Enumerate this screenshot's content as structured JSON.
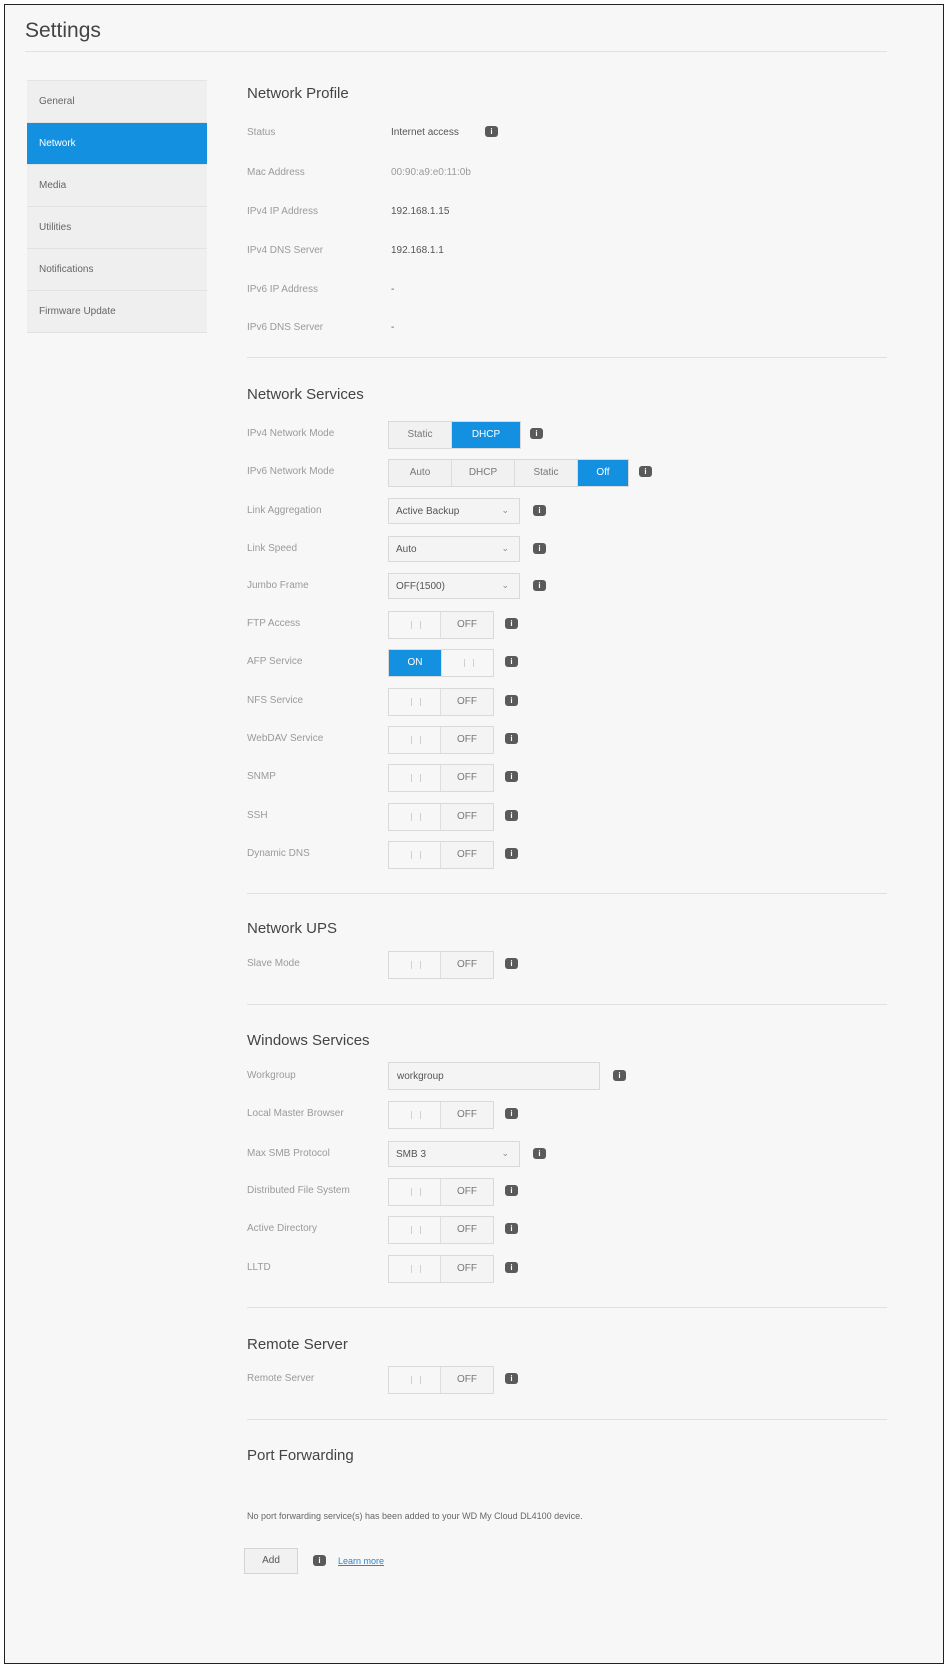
{
  "page_title": "Settings",
  "accent_color": "#1391e0",
  "sidebar": {
    "items": [
      {
        "label": "General"
      },
      {
        "label": "Network",
        "active": true
      },
      {
        "label": "Media"
      },
      {
        "label": "Utilities"
      },
      {
        "label": "Notifications"
      },
      {
        "label": "Firmware Update"
      }
    ]
  },
  "network_profile": {
    "title": "Network Profile",
    "status_label": "Status",
    "status_value": "Internet access",
    "mac_label": "Mac Address",
    "mac_value": "00:90:a9:e0:11:0b",
    "ipv4_ip_label": "IPv4 IP Address",
    "ipv4_ip_value": "192.168.1.15",
    "ipv4_dns_label": "IPv4 DNS Server",
    "ipv4_dns_value": "192.168.1.1",
    "ipv6_ip_label": "IPv6 IP Address",
    "ipv6_ip_value": "-",
    "ipv6_dns_label": "IPv6 DNS Server",
    "ipv6_dns_value": "-"
  },
  "network_services": {
    "title": "Network Services",
    "ipv4_mode_label": "IPv4 Network Mode",
    "ipv4_mode_options": [
      "Static",
      "DHCP"
    ],
    "ipv4_mode_selected": "DHCP",
    "ipv6_mode_label": "IPv6 Network Mode",
    "ipv6_mode_options": [
      "Auto",
      "DHCP",
      "Static",
      "Off"
    ],
    "ipv6_mode_selected": "Off",
    "link_agg_label": "Link Aggregation",
    "link_agg_value": "Active Backup",
    "link_speed_label": "Link Speed",
    "link_speed_value": "Auto",
    "jumbo_label": "Jumbo Frame",
    "jumbo_value": "OFF(1500)",
    "ftp_label": "FTP Access",
    "afp_label": "AFP Service",
    "nfs_label": "NFS Service",
    "webdav_label": "WebDAV Service",
    "snmp_label": "SNMP",
    "ssh_label": "SSH",
    "ddns_label": "Dynamic DNS"
  },
  "toggle_text": {
    "on": "ON",
    "off": "OFF"
  },
  "network_ups": {
    "title": "Network UPS",
    "slave_label": "Slave Mode"
  },
  "windows_services": {
    "title": "Windows Services",
    "workgroup_label": "Workgroup",
    "workgroup_value": "workgroup",
    "lmb_label": "Local Master Browser",
    "smb_label": "Max SMB Protocol",
    "smb_value": "SMB 3",
    "dfs_label": "Distributed File System",
    "ad_label": "Active Directory",
    "lltd_label": "LLTD"
  },
  "remote_server": {
    "title": "Remote Server",
    "label": "Remote Server"
  },
  "port_forwarding": {
    "title": "Port Forwarding",
    "description": "No port forwarding service(s) has been added to your WD My Cloud DL4100 device.",
    "add_label": "Add",
    "learn_more": "Learn more"
  },
  "icons": {
    "info": "info-icon",
    "dropdown": "chevron-down-icon"
  }
}
